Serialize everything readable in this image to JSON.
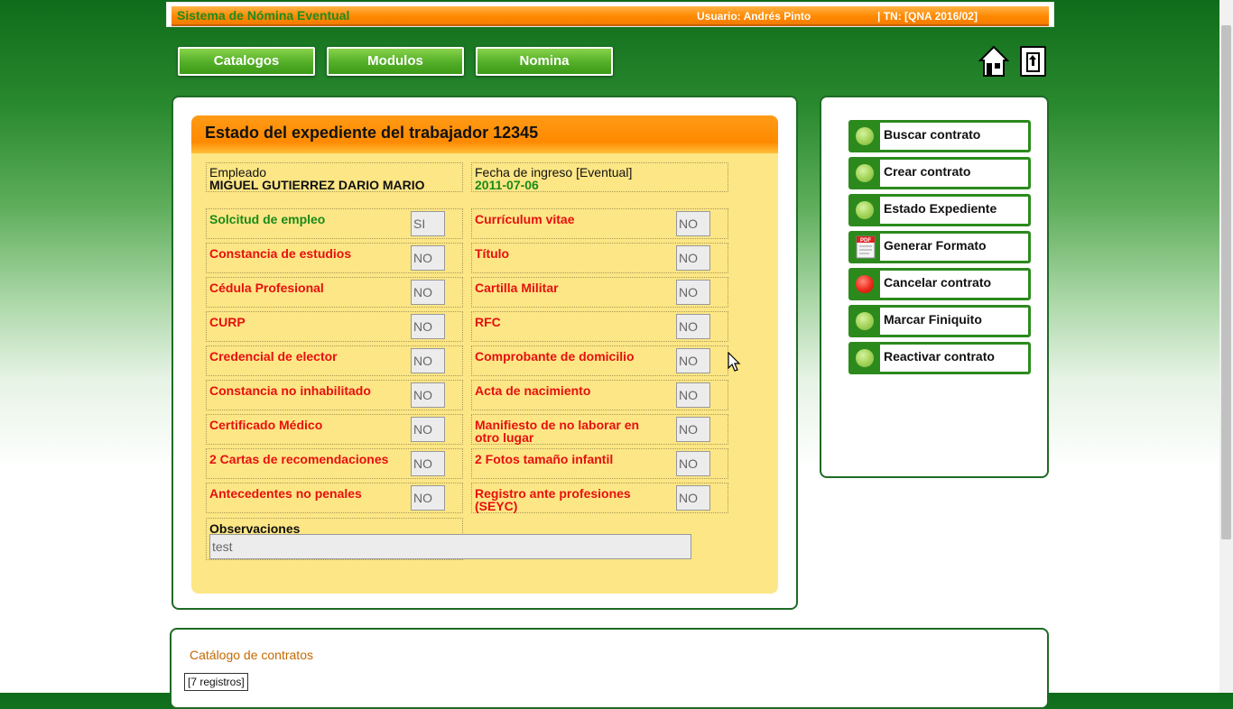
{
  "header": {
    "app_title": "Sistema de Nómina Eventual",
    "user": "Usuario: Andrés Pinto",
    "period": "| TN: [QNA 2016/02]"
  },
  "nav": [
    "Catalogos",
    "Modulos",
    "Nomina"
  ],
  "top_icons": [
    "home-icon",
    "exit-icon"
  ],
  "record": {
    "title": "Estado del expediente del trabajador 12345",
    "employee_label": "Empleado",
    "employee_name": "MIGUEL GUTIERREZ DARIO MARIO",
    "date_label": "Fecha de ingreso [Eventual]",
    "date_value": "2011-07-06",
    "rows": [
      [
        {
          "label": "Solcitud de empleo",
          "value": "SI",
          "status": "green"
        },
        {
          "label": "Currículum vitae",
          "value": "NO",
          "status": "red"
        }
      ],
      [
        {
          "label": "Constancia de estudios",
          "value": "NO",
          "status": "red"
        },
        {
          "label": "Título",
          "value": "NO",
          "status": "red"
        }
      ],
      [
        {
          "label": "Cédula Profesional",
          "value": "NO",
          "status": "red"
        },
        {
          "label": "Cartilla Militar",
          "value": "NO",
          "status": "red"
        }
      ],
      [
        {
          "label": "CURP",
          "value": "NO",
          "status": "red"
        },
        {
          "label": "RFC",
          "value": "NO",
          "status": "red"
        }
      ],
      [
        {
          "label": "Credencial de elector",
          "value": "NO",
          "status": "red"
        },
        {
          "label": "Comprobante de domicilio",
          "value": "NO",
          "status": "red"
        }
      ],
      [
        {
          "label": "Constancia no inhabilitado",
          "value": "NO",
          "status": "red"
        },
        {
          "label": "Acta de nacimiento",
          "value": "NO",
          "status": "red"
        }
      ],
      [
        {
          "label": "Certificado Médico",
          "value": "NO",
          "status": "red"
        },
        {
          "label": "Manifiesto de no laborar en otro lugar",
          "value": "NO",
          "status": "red"
        }
      ],
      [
        {
          "label": "2 Cartas de recomendaciones",
          "value": "NO",
          "status": "red"
        },
        {
          "label": "2 Fotos tamaño infantil",
          "value": "NO",
          "status": "red"
        }
      ],
      [
        {
          "label": "Antecedentes no penales",
          "value": "NO",
          "status": "red"
        },
        {
          "label": "Registro ante profesiones (SEYC)",
          "value": "NO",
          "status": "red"
        }
      ]
    ],
    "observations_label": "Observaciones",
    "observations_value": "test"
  },
  "side_menu": [
    {
      "label": "Buscar contrato",
      "icon": "green-dot-icon"
    },
    {
      "label": "Crear contrato",
      "icon": "green-dot-icon"
    },
    {
      "label": "Estado Expediente",
      "icon": "green-dot-icon"
    },
    {
      "label": "Generar Formato",
      "icon": "pdf-icon"
    },
    {
      "label": "Cancelar contrato",
      "icon": "red-dot-icon"
    },
    {
      "label": "Marcar Finiquito",
      "icon": "green-dot-icon"
    },
    {
      "label": "Reactivar contrato",
      "icon": "green-dot-icon"
    }
  ],
  "catalog": {
    "title": "Catálogo de contratos",
    "records": "[7 registros]"
  },
  "colors": {
    "accent_orange": "#ff8a00",
    "green": "#2c8a1d",
    "required_missing": "#e61010",
    "delivered": "#1a8a1a",
    "panel_fill": "#fde685"
  }
}
